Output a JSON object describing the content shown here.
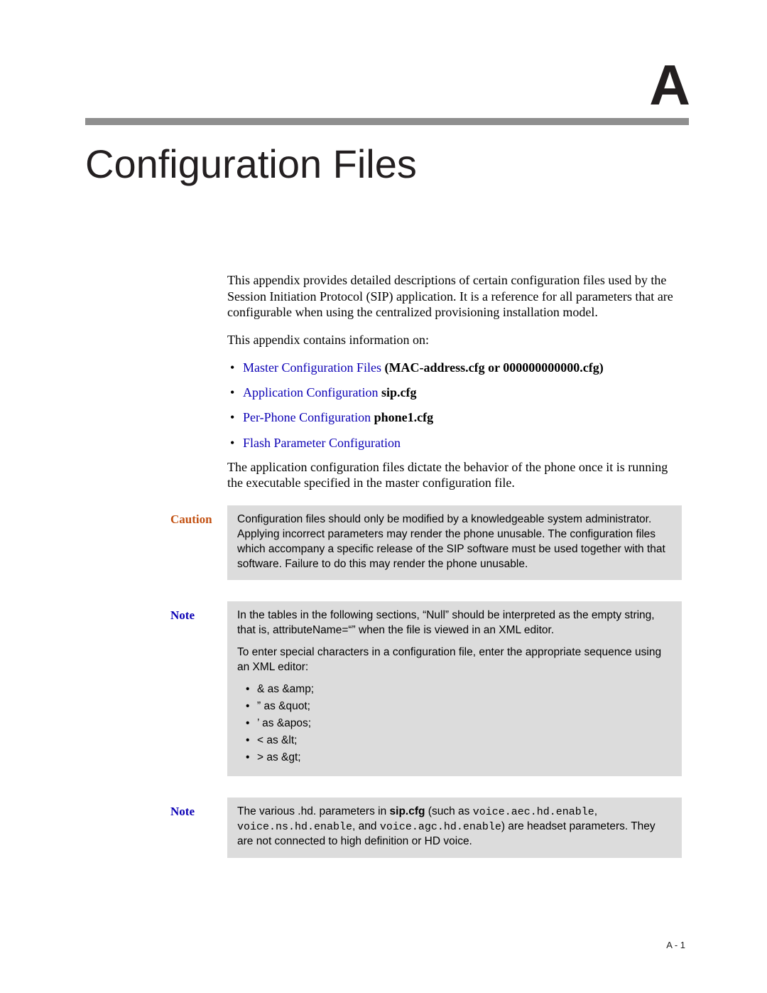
{
  "appendix_letter": "A",
  "page_title": "Configuration Files",
  "intro_para": "This appendix provides detailed descriptions of certain configuration files used by the Session Initiation Protocol (SIP) application. It is a reference for all parameters that are configurable when using the centralized provisioning installation model.",
  "intro_list_lead": "This appendix contains information on:",
  "links": [
    {
      "link": "Master Configuration Files",
      "suffix_bold": " (MAC-address.cfg or 000000000000.cfg)"
    },
    {
      "link": "Application Configuration",
      "suffix_bold": " sip.cfg"
    },
    {
      "link": "Per-Phone Configuration",
      "suffix_bold": " phone1.cfg"
    },
    {
      "link": "Flash Parameter Configuration",
      "suffix_bold": ""
    }
  ],
  "post_list_para": "The application configuration files dictate the behavior of the phone once it is running the executable specified in the master configuration file.",
  "caution": {
    "label": "Caution",
    "body": "Configuration files should only be modified by a knowledgeable system administrator. Applying incorrect parameters may render the phone unusable. The configuration files which accompany a specific release of the SIP software must be used together with that software. Failure to do this may render the phone unusable."
  },
  "note1": {
    "label": "Note",
    "p1": "In the tables in the following sections, “Null” should be interpreted as the empty string, that is, attributeName=“” when the file is viewed in an XML editor.",
    "p2": "To enter special characters in a configuration file, enter the appropriate sequence using an XML editor:",
    "items": [
      "& as &amp;",
      "” as &quot;",
      "’ as &apos;",
      "< as &lt;",
      "> as &gt;"
    ]
  },
  "note2": {
    "label": "Note",
    "pre": "The various .hd. parameters in ",
    "bold1": "sip.cfg",
    "mid1": " (such as ",
    "mono1": "voice.aec.hd.enable",
    "mid2": ", ",
    "mono2": "voice.ns.hd.enable",
    "mid3": ", and ",
    "mono3": "voice.agc.hd.enable",
    "post": ") are headset parameters. They are not connected to high definition or HD voice."
  },
  "page_number": "A - 1"
}
